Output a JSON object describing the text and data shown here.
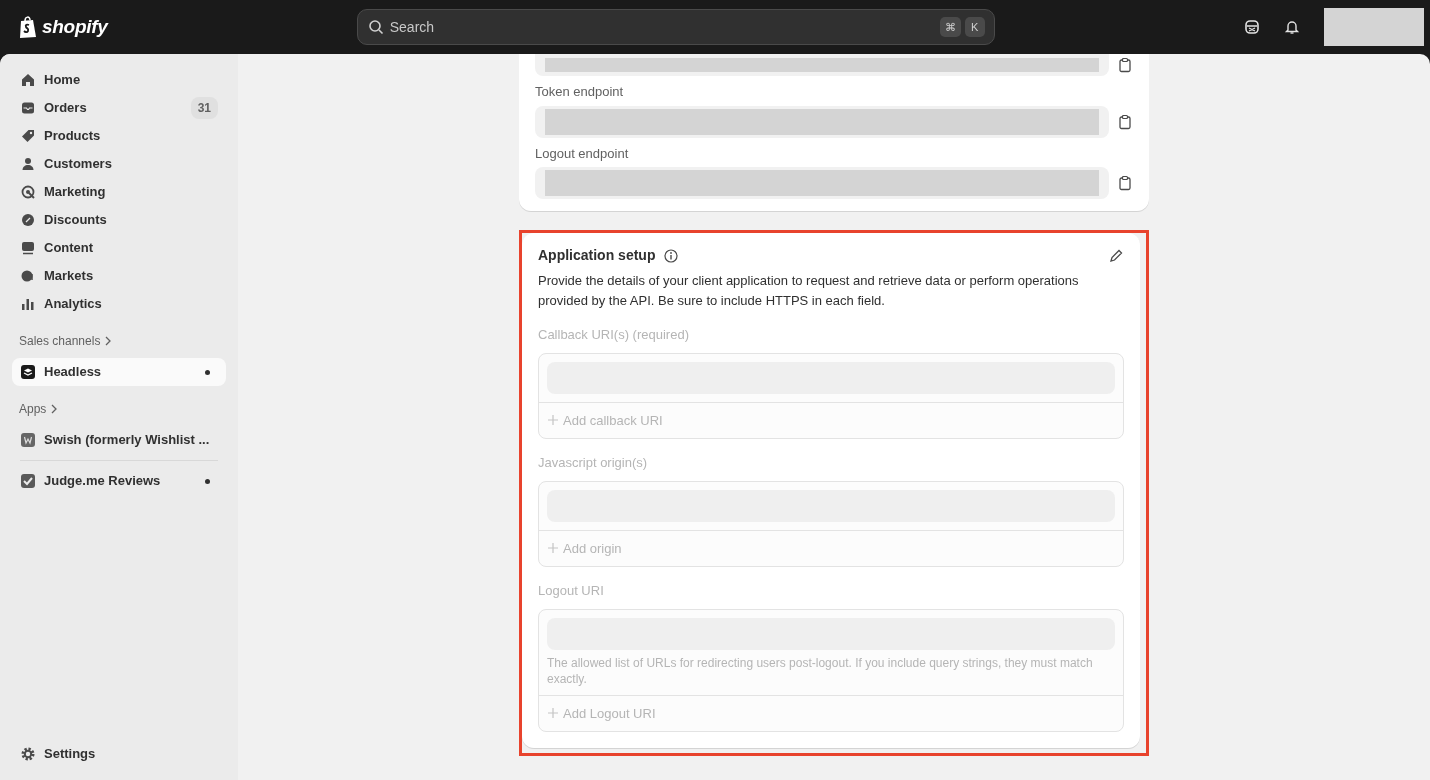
{
  "topbar": {
    "logo_text": "shopify",
    "search": {
      "placeholder": "Search",
      "shortcut_keys": [
        "⌘",
        "K"
      ]
    }
  },
  "sidebar": {
    "items": [
      {
        "label": "Home",
        "selected": false
      },
      {
        "label": "Orders",
        "selected": false,
        "badge": "31"
      },
      {
        "label": "Products",
        "selected": false
      },
      {
        "label": "Customers",
        "selected": false
      },
      {
        "label": "Marketing",
        "selected": false
      },
      {
        "label": "Discounts",
        "selected": false
      },
      {
        "label": "Content",
        "selected": false
      },
      {
        "label": "Markets",
        "selected": false
      },
      {
        "label": "Analytics",
        "selected": false
      }
    ],
    "sections": [
      {
        "title": "Sales channels",
        "items": [
          {
            "label": "Headless",
            "selected": true,
            "dot": true
          }
        ]
      },
      {
        "title": "Apps",
        "items": [
          {
            "label": "Swish (formerly Wishlist ...",
            "selected": false,
            "dot": false
          },
          {
            "label": "Judge.me Reviews",
            "selected": false,
            "dot": true
          }
        ]
      }
    ],
    "settings": {
      "label": "Settings"
    }
  },
  "endpoints_card": {
    "fields": [
      {
        "redacted": true
      },
      {
        "label": "Token endpoint",
        "redacted": true
      },
      {
        "label": "Logout endpoint",
        "redacted": true
      }
    ]
  },
  "application_setup": {
    "title": "Application setup",
    "highlighted": true,
    "disabled": true,
    "description": "Provide the details of your client application to request and retrieve data or perform operations provided by the API. Be sure to include HTTPS in each field.",
    "groups": [
      {
        "label": "Callback URI(s) (required)",
        "add_label": "Add callback URI"
      },
      {
        "label": "Javascript origin(s)",
        "add_label": "Add origin"
      },
      {
        "label": "Logout URI",
        "help": "The allowed list of URLs for redirecting users post-logout. If you include query strings, they must match exactly.",
        "add_label": "Add Logout URI"
      }
    ]
  }
}
